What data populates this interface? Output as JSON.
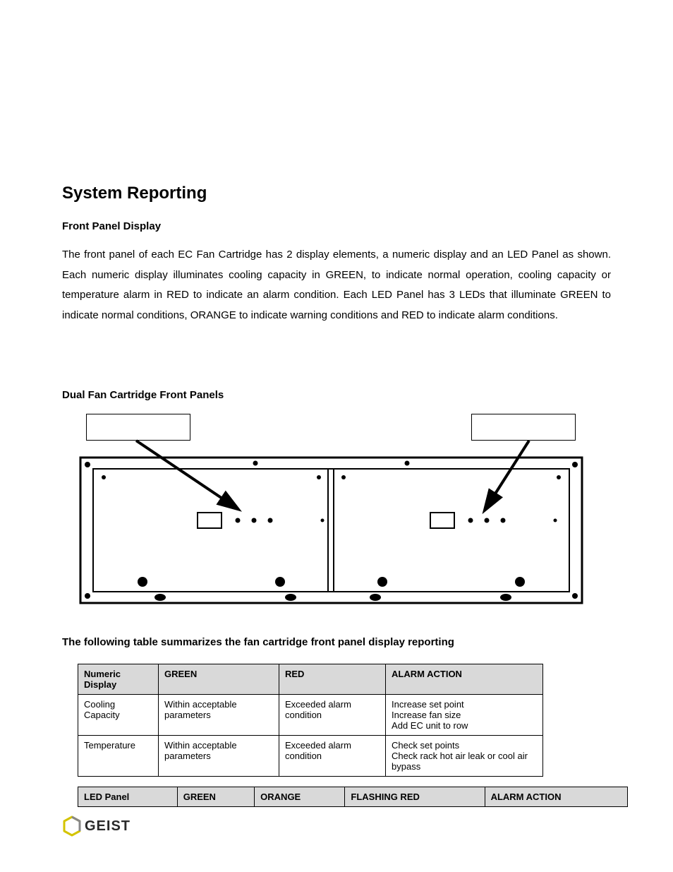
{
  "title": "System Reporting",
  "subhead1": "Front Panel Display",
  "para1": "The front panel of each EC Fan Cartridge has 2 display elements, a numeric display and an LED Panel as shown. Each numeric display illuminates cooling capacity in GREEN, to indicate normal operation, cooling capacity or temperature alarm in RED to indicate an alarm condition.  Each LED Panel has 3 LEDs that illuminate GREEN to indicate normal conditions, ORANGE to indicate warning conditions and RED to indicate alarm conditions.",
  "subhead2": "Dual Fan Cartridge Front Panels",
  "table_intro": "The following table summarizes the fan cartridge front panel display reporting",
  "table1": {
    "headers": [
      "Numeric Display",
      "GREEN",
      "RED",
      "ALARM ACTION"
    ],
    "rows": [
      {
        "c0": "Cooling Capacity",
        "c1": "Within acceptable parameters",
        "c2": "Exceeded alarm condition",
        "c3a": "Increase set point",
        "c3b": "Increase fan size",
        "c3c": "Add EC unit to row"
      },
      {
        "c0": "Temperature",
        "c1": "Within acceptable parameters",
        "c2": "Exceeded alarm condition",
        "c3a": "Check set points",
        "c3b": "Check rack hot air leak or cool air bypass",
        "c3c": ""
      }
    ]
  },
  "table2": {
    "headers": [
      "LED Panel",
      "GREEN",
      "ORANGE",
      "FLASHING RED",
      "ALARM ACTION"
    ]
  },
  "logo_text": "GEIST"
}
